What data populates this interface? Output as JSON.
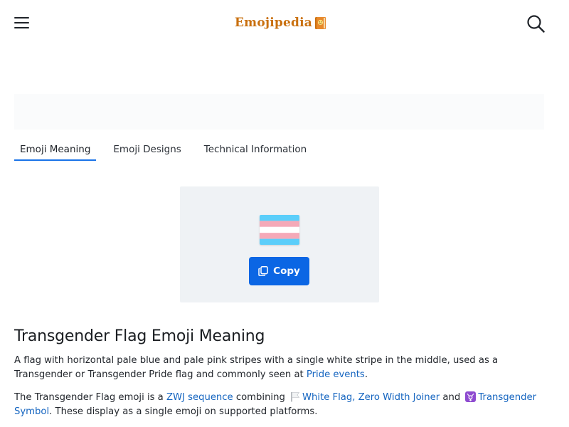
{
  "header": {
    "logo_text": "Emojipedia",
    "menu_icon": "hamburger-menu-icon",
    "search_icon": "search-icon",
    "brand_color": "#c9700f"
  },
  "tabs": [
    {
      "label": "Emoji Meaning",
      "active": true
    },
    {
      "label": "Emoji Designs",
      "active": false
    },
    {
      "label": "Technical Information",
      "active": false
    }
  ],
  "preview": {
    "emoji_name": "transgender-flag-emoji",
    "copy_label": "Copy",
    "flag_colors": [
      "#5bcefa",
      "#f5a9b8",
      "#ffffff",
      "#f5a9b8",
      "#5bcefa"
    ]
  },
  "content": {
    "heading": "Transgender Flag Emoji Meaning",
    "para1": {
      "text_before": "A flag with horizontal pale blue and pale pink stripes with a single white stripe in the middle, used as a Transgender or Transgender Pride flag and commonly seen at ",
      "link": "Pride events",
      "text_after": "."
    },
    "para2": {
      "text_1": "The Transgender Flag emoji is a ",
      "link_zwj": "ZWJ sequence",
      "text_2": " combining ",
      "link_components": "White Flag, Zero Width Joiner",
      "text_3": " and ",
      "link_symbol": "Transgender Symbol",
      "text_4": ". These display as a single emoji on supported platforms."
    }
  },
  "colors": {
    "accent": "#0b66e4",
    "link": "#1565c0",
    "tab_underline": "#1a73e8"
  }
}
